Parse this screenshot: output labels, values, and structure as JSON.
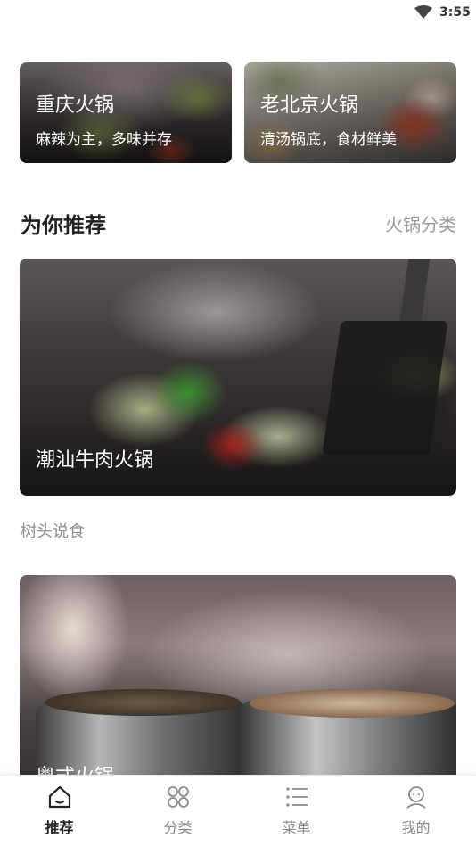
{
  "status_bar": {
    "time": "3:55",
    "icon": "wifi-icon"
  },
  "top_cards": [
    {
      "title": "重庆火锅",
      "subtitle": "麻辣为主，多味并存"
    },
    {
      "title": "老北京火锅",
      "subtitle": "清汤锅底，食材鲜美"
    }
  ],
  "section": {
    "title": "为你推荐",
    "more": "火锅分类"
  },
  "feed": [
    {
      "title": "潮汕牛肉火锅",
      "author": "树头说食"
    },
    {
      "title": "粤式火锅"
    }
  ],
  "bottom_nav": {
    "items": [
      {
        "label": "推荐",
        "icon": "home-icon",
        "active": true
      },
      {
        "label": "分类",
        "icon": "category-grid-icon",
        "active": false
      },
      {
        "label": "菜单",
        "icon": "menu-list-icon",
        "active": false
      },
      {
        "label": "我的",
        "icon": "profile-icon",
        "active": false
      }
    ]
  },
  "colors": {
    "active_nav": "#222222",
    "inactive_nav": "#888888",
    "muted_text": "#9a9a9a"
  }
}
